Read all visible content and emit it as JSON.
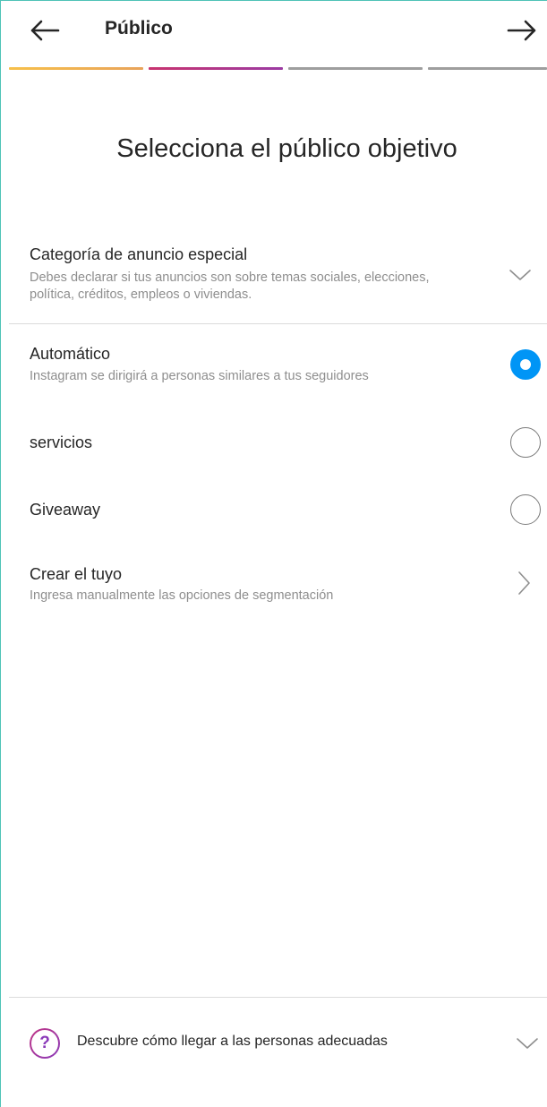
{
  "header": {
    "title": "Público",
    "back_icon": "arrow-left-icon",
    "next_icon": "arrow-right-icon"
  },
  "progress": {
    "steps_total": 4,
    "current_step": 2,
    "colors": [
      "#f5b342",
      "#b5338a",
      "#9e9e9e",
      "#9e9e9e"
    ]
  },
  "main": {
    "heading": "Selecciona el público objetivo",
    "special_category": {
      "title": "Categoría de anuncio especial",
      "subtitle": "Debes declarar si tus anuncios son sobre temas sociales, elecciones, política, créditos, empleos o viviendas.",
      "icon": "chevron-down-icon"
    },
    "options": [
      {
        "label": "Automático",
        "subtitle": "Instagram se dirigirá a personas similares a tus seguidores",
        "selected": true
      },
      {
        "label": "servicios",
        "subtitle": "",
        "selected": false
      },
      {
        "label": "Giveaway",
        "subtitle": "",
        "selected": false
      }
    ],
    "create_own": {
      "title": "Crear el tuyo",
      "subtitle": "Ingresa manualmente las opciones de segmentación",
      "icon": "chevron-right-icon"
    }
  },
  "footer": {
    "help_glyph": "?",
    "help_text": "Descubre cómo llegar a las personas adecuadas",
    "icon": "chevron-down-icon"
  },
  "colors": {
    "accent": "#0095f6",
    "text": "#262626",
    "secondary_text": "#8e8e8e"
  }
}
